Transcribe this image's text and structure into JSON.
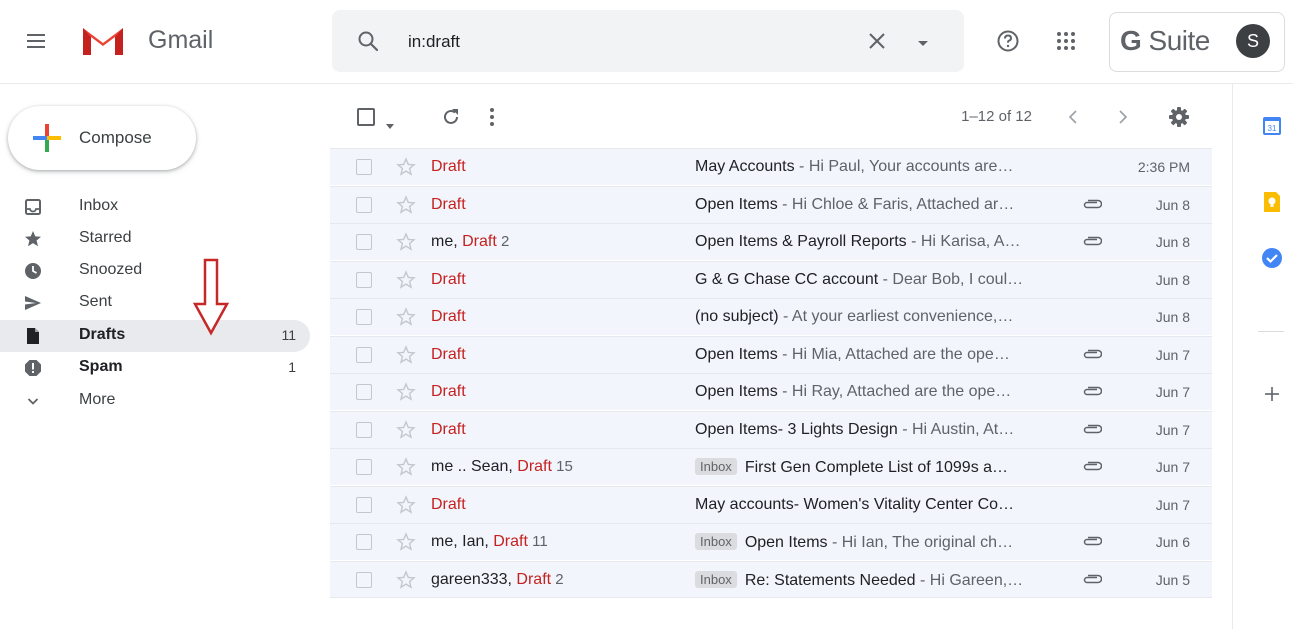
{
  "header": {
    "brand": "Gmail",
    "search_value": "in:draft",
    "gsuite_bold": "G",
    "gsuite_light": " Suite",
    "avatar_letter": "S"
  },
  "sidebar": {
    "compose_label": "Compose",
    "items": [
      {
        "label": "Inbox",
        "count": "",
        "icon": "inbox-icon"
      },
      {
        "label": "Starred",
        "count": "",
        "icon": "star-icon"
      },
      {
        "label": "Snoozed",
        "count": "",
        "icon": "clock-icon"
      },
      {
        "label": "Sent",
        "count": "",
        "icon": "send-icon"
      },
      {
        "label": "Drafts",
        "count": "11",
        "icon": "draft-icon"
      },
      {
        "label": "Spam",
        "count": "1",
        "icon": "spam-icon"
      },
      {
        "label": "More",
        "count": "",
        "icon": "chevron-down-icon"
      }
    ]
  },
  "toolbar": {
    "pager": "1–12 of 12"
  },
  "emails": [
    {
      "from": "",
      "draft": "Draft",
      "num": "",
      "badge": "",
      "subject": "May Accounts",
      "snippet": " - Hi Paul, Your accounts are…",
      "attach": false,
      "date": "2:36 PM"
    },
    {
      "from": "",
      "draft": "Draft",
      "num": "",
      "badge": "",
      "subject": "Open Items",
      "snippet": " - Hi Chloe & Faris, Attached ar…",
      "attach": true,
      "date": "Jun 8"
    },
    {
      "from": "me, ",
      "draft": "Draft",
      "num": " 2",
      "badge": "",
      "subject": "Open Items & Payroll Reports",
      "snippet": " - Hi Karisa, A…",
      "attach": true,
      "date": "Jun 8"
    },
    {
      "from": "",
      "draft": "Draft",
      "num": "",
      "badge": "",
      "subject": "G & G Chase CC account",
      "snippet": " - Dear Bob, I coul…",
      "attach": false,
      "date": "Jun 8"
    },
    {
      "from": "",
      "draft": "Draft",
      "num": "",
      "badge": "",
      "subject": "(no subject)",
      "snippet": " - At your earliest convenience,…",
      "attach": false,
      "date": "Jun 8"
    },
    {
      "from": "",
      "draft": "Draft",
      "num": "",
      "badge": "",
      "subject": "Open Items",
      "snippet": " - Hi Mia, Attached are the ope…",
      "attach": true,
      "date": "Jun 7"
    },
    {
      "from": "",
      "draft": "Draft",
      "num": "",
      "badge": "",
      "subject": "Open Items",
      "snippet": " - Hi Ray, Attached are the ope…",
      "attach": true,
      "date": "Jun 7"
    },
    {
      "from": "",
      "draft": "Draft",
      "num": "",
      "badge": "",
      "subject": "Open Items- 3 Lights Design",
      "snippet": " - Hi Austin, At…",
      "attach": true,
      "date": "Jun 7"
    },
    {
      "from": "me .. Sean, ",
      "draft": "Draft",
      "num": " 15",
      "badge": "Inbox",
      "subject": "First Gen Complete List of 1099s a…",
      "snippet": "",
      "attach": true,
      "date": "Jun 7"
    },
    {
      "from": "",
      "draft": "Draft",
      "num": "",
      "badge": "",
      "subject": "May accounts- Women's Vitality Center Co…",
      "snippet": "",
      "attach": false,
      "date": "Jun 7"
    },
    {
      "from": "me, Ian, ",
      "draft": "Draft",
      "num": " 11",
      "badge": "Inbox",
      "subject": "Open Items",
      "snippet": " - Hi Ian, The original ch…",
      "attach": true,
      "date": "Jun 6"
    },
    {
      "from": "gareen333, ",
      "draft": "Draft",
      "num": " 2",
      "badge": "Inbox",
      "subject": "Re: Statements Needed",
      "snippet": " - Hi Gareen,…",
      "attach": true,
      "date": "Jun 5"
    }
  ],
  "colors": {
    "draft_red": "#c5221f",
    "row_bg": "#f2f6fc",
    "active_nav": "#e8eaed",
    "arrow_red": "#c62828"
  }
}
